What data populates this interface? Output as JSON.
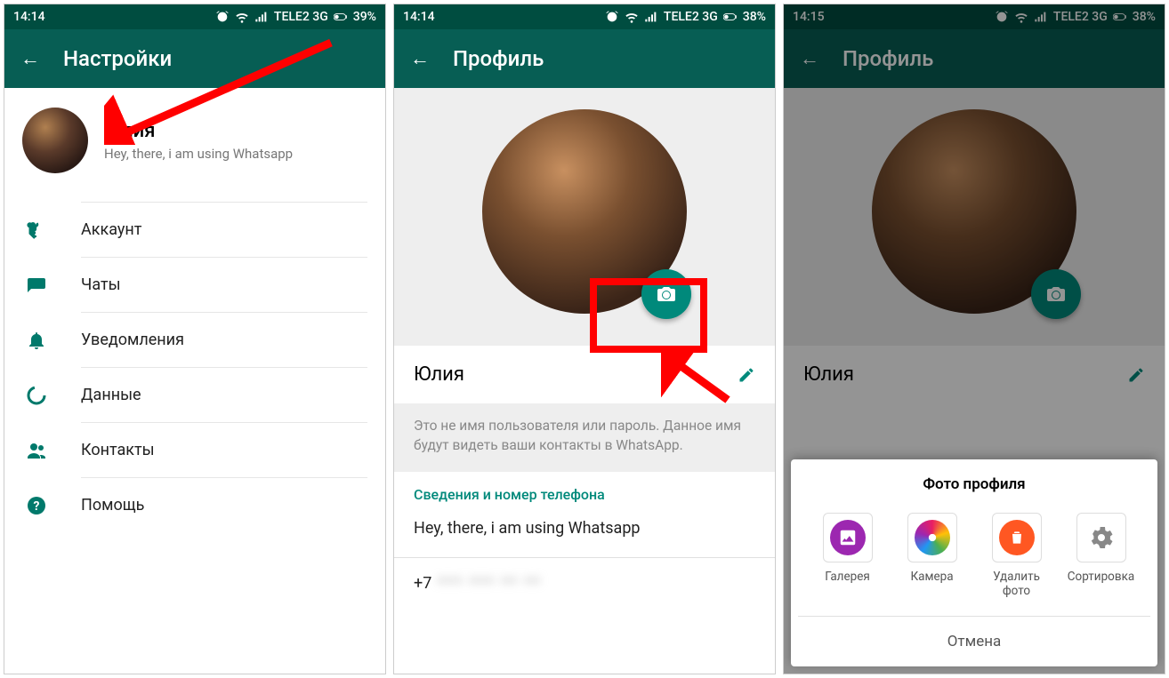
{
  "status": {
    "times": [
      "14:14",
      "14:14",
      "14:15"
    ],
    "carrier": "TELE2 3G",
    "battery": [
      "39%",
      "38%",
      "38%"
    ]
  },
  "screen1": {
    "title": "Настройки",
    "profile": {
      "name": "Юлия",
      "status": "Hey, there, i am using Whatsapp"
    },
    "menu": [
      {
        "label": "Аккаунт",
        "icon": "key"
      },
      {
        "label": "Чаты",
        "icon": "chat"
      },
      {
        "label": "Уведомления",
        "icon": "bell"
      },
      {
        "label": "Данные",
        "icon": "data"
      },
      {
        "label": "Контакты",
        "icon": "contacts"
      },
      {
        "label": "Помощь",
        "icon": "help"
      }
    ]
  },
  "screen2": {
    "title": "Профиль",
    "name": "Юлия",
    "hint": "Это не имя пользователя или пароль. Данное имя будут видеть ваши контакты в WhatsApp.",
    "section_label": "Сведения и номер телефона",
    "status_text": "Hey, there, i am using Whatsapp",
    "phone_prefix": "+7",
    "phone_hidden": " *** *** ** **"
  },
  "screen3": {
    "title": "Профиль",
    "name": "Юлия",
    "sheet": {
      "title": "Фото профиля",
      "options": [
        {
          "label": "Галерея"
        },
        {
          "label": "Камера"
        },
        {
          "label": "Удалить фото"
        },
        {
          "label": "Сортировка"
        }
      ],
      "cancel": "Отмена"
    }
  }
}
